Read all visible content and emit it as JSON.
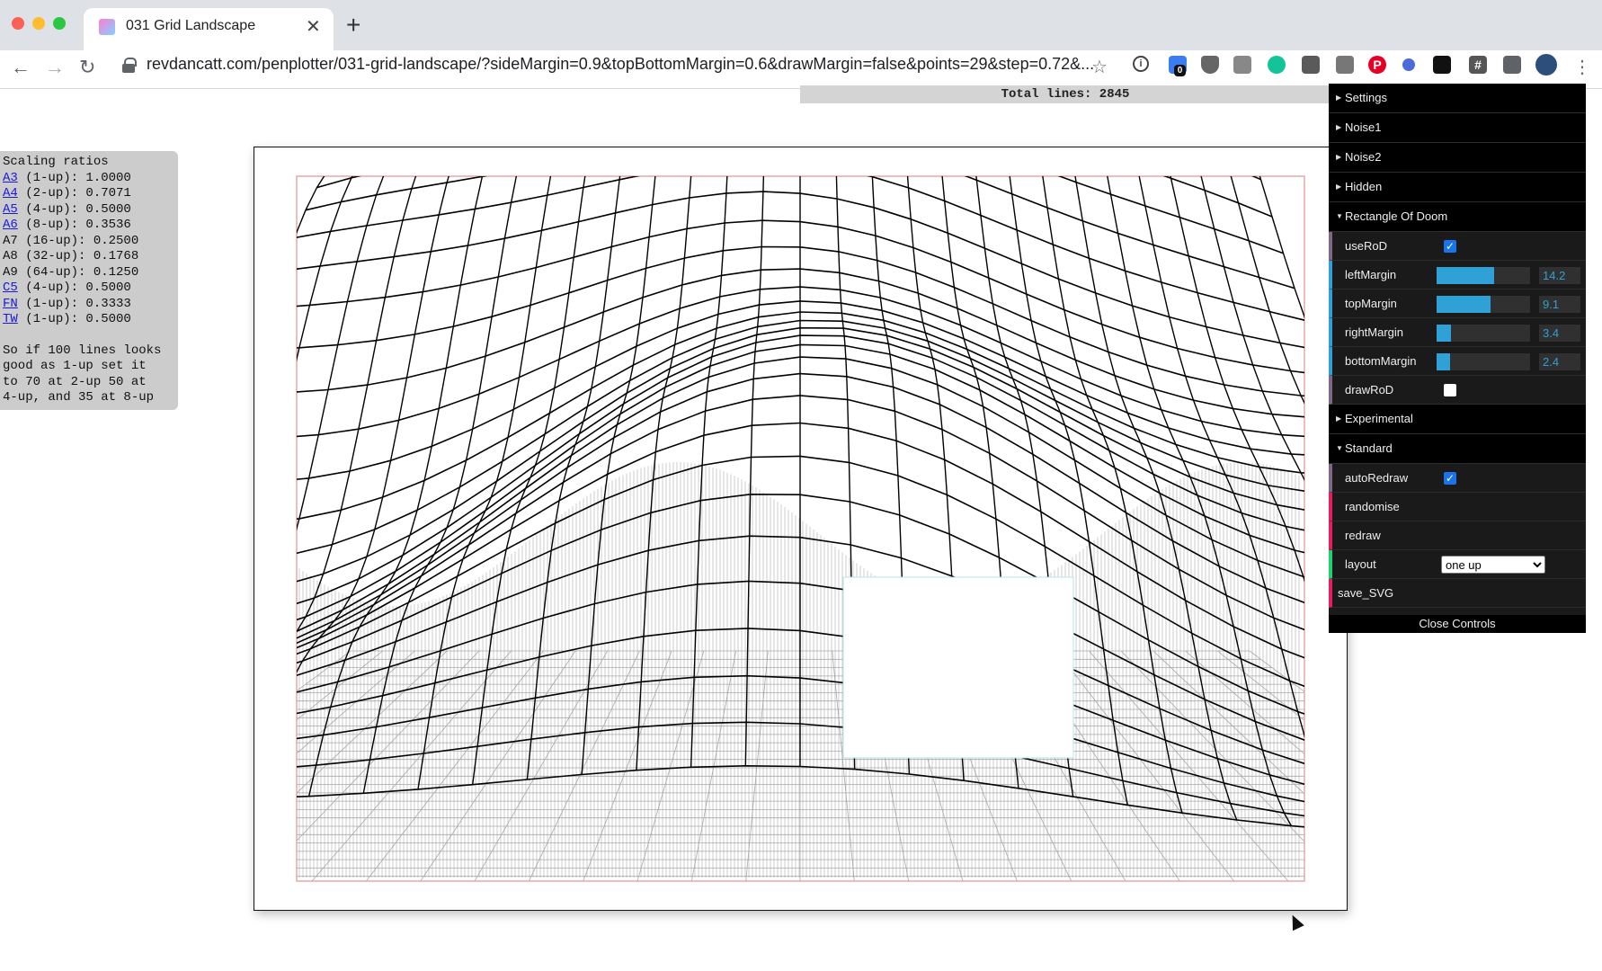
{
  "browser": {
    "tab_title": "031 Grid Landscape",
    "url": "revdancatt.com/penplotter/031-grid-landscape/?sideMargin=0.9&topBottomMargin=0.6&drawMargin=false&points=29&step=0.72&...",
    "extension_badge": "0"
  },
  "page": {
    "total_lines": "Total lines: 2845",
    "ratios": {
      "title": "Scaling ratios",
      "rows": [
        {
          "link": "A3",
          "text": " (1-up): 1.0000"
        },
        {
          "link": "A4",
          "text": " (2-up): 0.7071"
        },
        {
          "link": "A5",
          "text": " (4-up): 0.5000"
        },
        {
          "link": "A6",
          "text": " (8-up): 0.3536"
        },
        {
          "link": "",
          "text": "A7 (16-up): 0.2500"
        },
        {
          "link": "",
          "text": "A8 (32-up): 0.1768"
        },
        {
          "link": "",
          "text": "A9 (64-up): 0.1250"
        },
        {
          "link": "C5",
          "text": " (4-up): 0.5000"
        },
        {
          "link": "FN",
          "text": " (1-up): 0.3333"
        },
        {
          "link": "TW",
          "text": " (1-up): 0.5000"
        }
      ],
      "note": "So if 100 lines looks\ngood as 1-up set it\nto 70 at 2-up 50 at\n4-up, and 35 at 8-up"
    }
  },
  "gui": {
    "folders": {
      "settings": "Settings",
      "noise1": "Noise1",
      "noise2": "Noise2",
      "hidden": "Hidden",
      "rod": "Rectangle Of Doom",
      "experimental": "Experimental",
      "standard": "Standard"
    },
    "rod": {
      "useRoD": {
        "label": "useRoD",
        "checked": true
      },
      "leftMargin": {
        "label": "leftMargin",
        "value": "14.2",
        "fill": 0.62
      },
      "topMargin": {
        "label": "topMargin",
        "value": "9.1",
        "fill": 0.58
      },
      "rightMargin": {
        "label": "rightMargin",
        "value": "3.4",
        "fill": 0.15
      },
      "bottomMargin": {
        "label": "bottomMargin",
        "value": "2.4",
        "fill": 0.14
      },
      "drawRoD": {
        "label": "drawRoD",
        "checked": false
      }
    },
    "standard": {
      "autoRedraw": {
        "label": "autoRedraw",
        "checked": true
      },
      "randomise": "randomise",
      "redraw": "redraw",
      "layout": {
        "label": "layout",
        "selected": "one up"
      },
      "save_svg": "save_SVG"
    },
    "close": "Close Controls"
  }
}
